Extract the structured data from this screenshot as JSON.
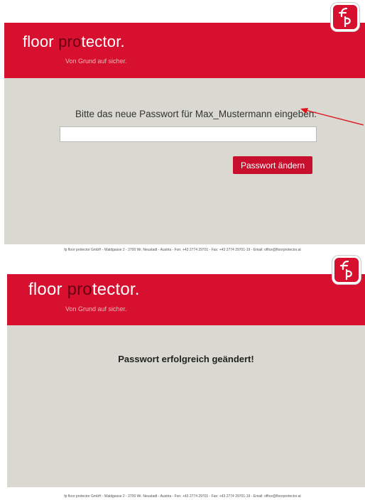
{
  "brand": {
    "logo_part1": "floor ",
    "logo_part2": "pro",
    "logo_part3": "tector",
    "logo_dot": ".",
    "tagline": "Von Grund auf sicher.",
    "badge_icon": "fp-logo-icon",
    "primary_color": "#d8102f"
  },
  "screen1": {
    "prompt": "Bitte das neue Passwort für Max_Mustermann eingeben:",
    "password_value": "",
    "submit_label": "Passwort ändern",
    "annotation_icon": "red-arrow-icon",
    "footer": "fp floor protector GmbH - Waldgasse 2 - 2700 Wr. Neustadt - Austria - Fon: +43 2774 29701 - Fax: +43 2774 29701-19 - Email: office@floorprotector.at"
  },
  "screen2": {
    "success_message": "Passwort erfolgreich geändert!",
    "footer": "fp floor protector GmbH - Waldgasse 2 - 2700 Wr. Neustadt - Austria - Fon: +43 2774 29701 - Fax: +43 2774 29701-19 - Email: office@floorprotector.at"
  }
}
